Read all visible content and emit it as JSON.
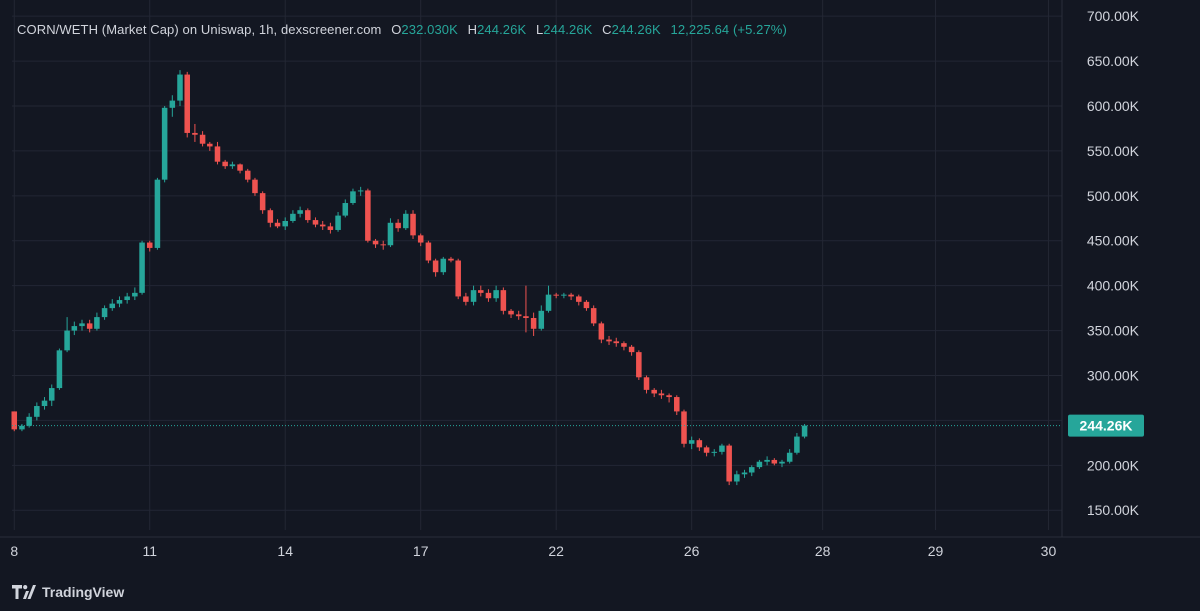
{
  "header": {
    "title": "CORN/WETH (Market Cap) on Uniswap, 1h, dexscreener.com",
    "open_label": "O",
    "open": "232.030K",
    "high_label": "H",
    "high": "244.26K",
    "low_label": "L",
    "low": "244.26K",
    "close_label": "C",
    "close": "244.26K",
    "change": "12,225.64 (+5.27%)"
  },
  "brand": {
    "name": "TradingView"
  },
  "colors": {
    "background": "#131722",
    "grid": "#232734",
    "up": "#26a69a",
    "down": "#ef5350",
    "text": "#d1d4dc",
    "price_tag": "#26a69a"
  },
  "chart_data": {
    "type": "candlestick",
    "title": "CORN/WETH (Market Cap) on Uniswap, 1h, dexscreener.com",
    "interval": "1h",
    "last_price": 244.26,
    "last_price_label": "244.26K",
    "y_unit": "K",
    "ylim": [
      128,
      718
    ],
    "y_ticks": [
      150,
      200,
      250,
      300,
      350,
      400,
      450,
      500,
      550,
      600,
      650,
      700
    ],
    "y_tick_labels": [
      "150.00K",
      "",
      "200.00K",
      "300.00K",
      "350.00K",
      "400.00K",
      "450.00K",
      "500.00K",
      "550.00K",
      "600.00K",
      "650.00K",
      "700.00K"
    ],
    "y_labeled": [
      {
        "v": 150,
        "label": "150.00K"
      },
      {
        "v": 200,
        "label": "200.00K"
      },
      {
        "v": 300,
        "label": "300.00K"
      },
      {
        "v": 350,
        "label": "350.00K"
      },
      {
        "v": 400,
        "label": "400.00K"
      },
      {
        "v": 450,
        "label": "450.00K"
      },
      {
        "v": 500,
        "label": "500.00K"
      },
      {
        "v": 550,
        "label": "550.00K"
      },
      {
        "v": 600,
        "label": "600.00K"
      },
      {
        "v": 650,
        "label": "650.00K"
      },
      {
        "v": 700,
        "label": "700.00K"
      }
    ],
    "x_ticks": [
      "8",
      "11",
      "14",
      "17",
      "22",
      "26",
      "28",
      "29",
      "30"
    ],
    "x_tick_positions": [
      0,
      3,
      6,
      9,
      12,
      15,
      17.9,
      20.4,
      22.9
    ],
    "xlim": [
      -0.05,
      23.2
    ],
    "grid": true,
    "candles": [
      [
        0.0,
        260,
        260,
        238,
        240
      ],
      [
        0.17,
        240,
        246,
        238,
        244
      ],
      [
        0.33,
        244,
        258,
        242,
        254
      ],
      [
        0.5,
        254,
        270,
        250,
        266
      ],
      [
        0.67,
        266,
        276,
        262,
        272
      ],
      [
        0.83,
        272,
        290,
        266,
        286
      ],
      [
        1.0,
        286,
        330,
        284,
        328
      ],
      [
        1.17,
        328,
        365,
        326,
        350
      ],
      [
        1.33,
        350,
        360,
        345,
        355
      ],
      [
        1.5,
        355,
        362,
        350,
        358
      ],
      [
        1.67,
        358,
        362,
        348,
        352
      ],
      [
        1.83,
        352,
        370,
        350,
        365
      ],
      [
        2.0,
        365,
        378,
        362,
        375
      ],
      [
        2.17,
        375,
        385,
        372,
        380
      ],
      [
        2.33,
        380,
        388,
        376,
        384
      ],
      [
        2.5,
        384,
        392,
        380,
        388
      ],
      [
        2.67,
        388,
        398,
        384,
        392
      ],
      [
        2.83,
        392,
        450,
        390,
        448
      ],
      [
        3.0,
        448,
        450,
        438,
        442
      ],
      [
        3.17,
        442,
        520,
        440,
        518
      ],
      [
        3.33,
        518,
        600,
        515,
        598
      ],
      [
        3.5,
        598,
        612,
        588,
        606
      ],
      [
        3.67,
        606,
        640,
        600,
        635
      ],
      [
        3.83,
        635,
        638,
        565,
        570
      ],
      [
        4.0,
        570,
        580,
        560,
        568
      ],
      [
        4.17,
        568,
        572,
        555,
        558
      ],
      [
        4.33,
        558,
        560,
        550,
        555
      ],
      [
        4.5,
        555,
        560,
        535,
        538
      ],
      [
        4.67,
        538,
        540,
        530,
        533
      ],
      [
        4.83,
        533,
        538,
        530,
        535
      ],
      [
        5.0,
        535,
        536,
        525,
        528
      ],
      [
        5.17,
        528,
        530,
        515,
        518
      ],
      [
        5.33,
        518,
        520,
        500,
        503
      ],
      [
        5.5,
        503,
        505,
        480,
        484
      ],
      [
        5.67,
        484,
        486,
        465,
        470
      ],
      [
        5.83,
        470,
        474,
        464,
        466
      ],
      [
        6.0,
        466,
        476,
        462,
        472
      ],
      [
        6.17,
        472,
        484,
        470,
        480
      ],
      [
        6.33,
        480,
        488,
        476,
        484
      ],
      [
        6.5,
        484,
        486,
        470,
        473
      ],
      [
        6.67,
        473,
        476,
        465,
        468
      ],
      [
        6.83,
        468,
        472,
        462,
        466
      ],
      [
        7.0,
        466,
        470,
        458,
        462
      ],
      [
        7.17,
        462,
        482,
        460,
        478
      ],
      [
        7.33,
        478,
        496,
        476,
        492
      ],
      [
        7.5,
        492,
        508,
        490,
        505
      ],
      [
        7.67,
        505,
        510,
        500,
        506
      ],
      [
        7.83,
        506,
        508,
        448,
        450
      ],
      [
        8.0,
        450,
        452,
        442,
        446
      ],
      [
        8.17,
        446,
        450,
        440,
        445
      ],
      [
        8.33,
        445,
        475,
        443,
        470
      ],
      [
        8.5,
        470,
        474,
        460,
        464
      ],
      [
        8.67,
        464,
        484,
        462,
        480
      ],
      [
        8.83,
        480,
        484,
        452,
        456
      ],
      [
        9.0,
        456,
        458,
        444,
        448
      ],
      [
        9.17,
        448,
        450,
        425,
        428
      ],
      [
        9.33,
        428,
        430,
        410,
        415
      ],
      [
        9.5,
        415,
        432,
        412,
        430
      ],
      [
        9.67,
        430,
        432,
        426,
        428
      ],
      [
        9.83,
        428,
        430,
        385,
        388
      ],
      [
        10.0,
        388,
        392,
        378,
        382
      ],
      [
        10.17,
        382,
        400,
        378,
        395
      ],
      [
        10.33,
        395,
        400,
        388,
        392
      ],
      [
        10.5,
        392,
        396,
        382,
        386
      ],
      [
        10.67,
        386,
        400,
        382,
        395
      ],
      [
        10.83,
        395,
        398,
        368,
        372
      ],
      [
        11.0,
        372,
        374,
        364,
        368
      ],
      [
        11.17,
        368,
        372,
        362,
        366
      ],
      [
        11.33,
        366,
        400,
        348,
        364
      ],
      [
        11.5,
        364,
        370,
        344,
        352
      ],
      [
        11.67,
        352,
        378,
        350,
        372
      ],
      [
        11.83,
        372,
        400,
        370,
        390
      ],
      [
        12.0,
        390,
        392,
        386,
        389
      ],
      [
        12.17,
        389,
        392,
        386,
        390
      ],
      [
        12.33,
        390,
        392,
        384,
        388
      ],
      [
        12.5,
        388,
        390,
        378,
        382
      ],
      [
        12.67,
        382,
        384,
        372,
        375
      ],
      [
        12.83,
        375,
        378,
        355,
        358
      ],
      [
        13.0,
        358,
        360,
        336,
        340
      ],
      [
        13.17,
        340,
        344,
        334,
        338
      ],
      [
        13.33,
        338,
        342,
        332,
        336
      ],
      [
        13.5,
        336,
        338,
        328,
        332
      ],
      [
        13.67,
        332,
        334,
        322,
        326
      ],
      [
        13.83,
        326,
        328,
        295,
        298
      ],
      [
        14.0,
        298,
        300,
        280,
        284
      ],
      [
        14.17,
        284,
        286,
        276,
        280
      ],
      [
        14.33,
        280,
        284,
        274,
        278
      ],
      [
        14.5,
        278,
        280,
        270,
        276
      ],
      [
        14.67,
        276,
        278,
        256,
        260
      ],
      [
        14.83,
        260,
        262,
        220,
        224
      ],
      [
        15.0,
        224,
        232,
        218,
        228
      ],
      [
        15.17,
        228,
        230,
        216,
        220
      ],
      [
        15.33,
        220,
        222,
        210,
        214
      ],
      [
        15.5,
        214,
        218,
        210,
        215
      ],
      [
        15.67,
        215,
        224,
        212,
        222
      ],
      [
        15.83,
        222,
        224,
        178,
        182
      ],
      [
        16.0,
        182,
        194,
        178,
        190
      ],
      [
        16.17,
        190,
        195,
        186,
        192
      ],
      [
        16.33,
        192,
        200,
        188,
        198
      ],
      [
        16.5,
        198,
        206,
        196,
        204
      ],
      [
        16.67,
        204,
        210,
        200,
        206
      ],
      [
        16.83,
        206,
        208,
        200,
        202
      ],
      [
        17.0,
        202,
        206,
        198,
        204
      ],
      [
        17.17,
        204,
        218,
        202,
        214
      ],
      [
        17.33,
        214,
        236,
        212,
        232
      ],
      [
        17.5,
        232,
        246,
        230,
        244.26
      ]
    ]
  }
}
